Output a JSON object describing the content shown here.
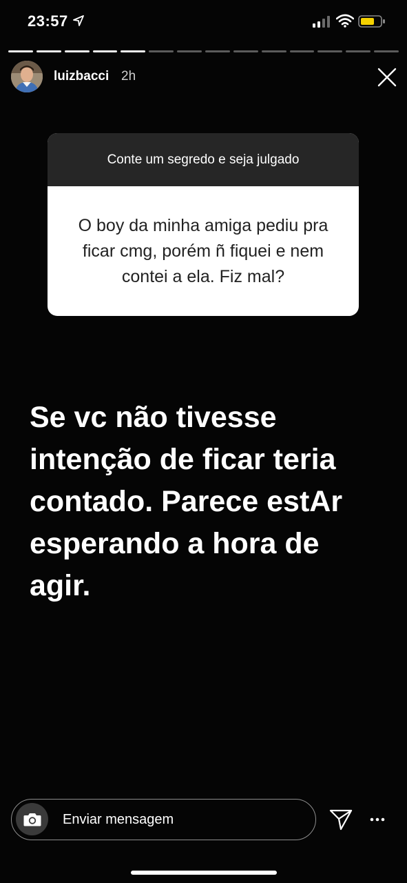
{
  "status_bar": {
    "time": "23:57",
    "battery_color": "#f5d100"
  },
  "progress": {
    "total_segments": 14,
    "completed_segments": 5
  },
  "header": {
    "username": "luizbacci",
    "time_ago": "2h"
  },
  "question_card": {
    "title": "Conte um segredo e seja julgado",
    "question": "O boy da minha amiga pediu pra ficar cmg, porém ñ fiquei e nem contei a ela. Fiz mal?"
  },
  "answer": {
    "text": "Se vc não tivesse intenção de ficar teria contado. Parece estAr esperando a hora de agir."
  },
  "bottom_bar": {
    "message_placeholder": "Enviar mensagem"
  },
  "icons": {
    "location": "location-arrow-icon",
    "signal": "cellular-signal-icon",
    "wifi": "wifi-icon",
    "battery": "battery-icon",
    "close": "close-icon",
    "camera": "camera-icon",
    "send": "send-icon",
    "more": "more-icon"
  }
}
